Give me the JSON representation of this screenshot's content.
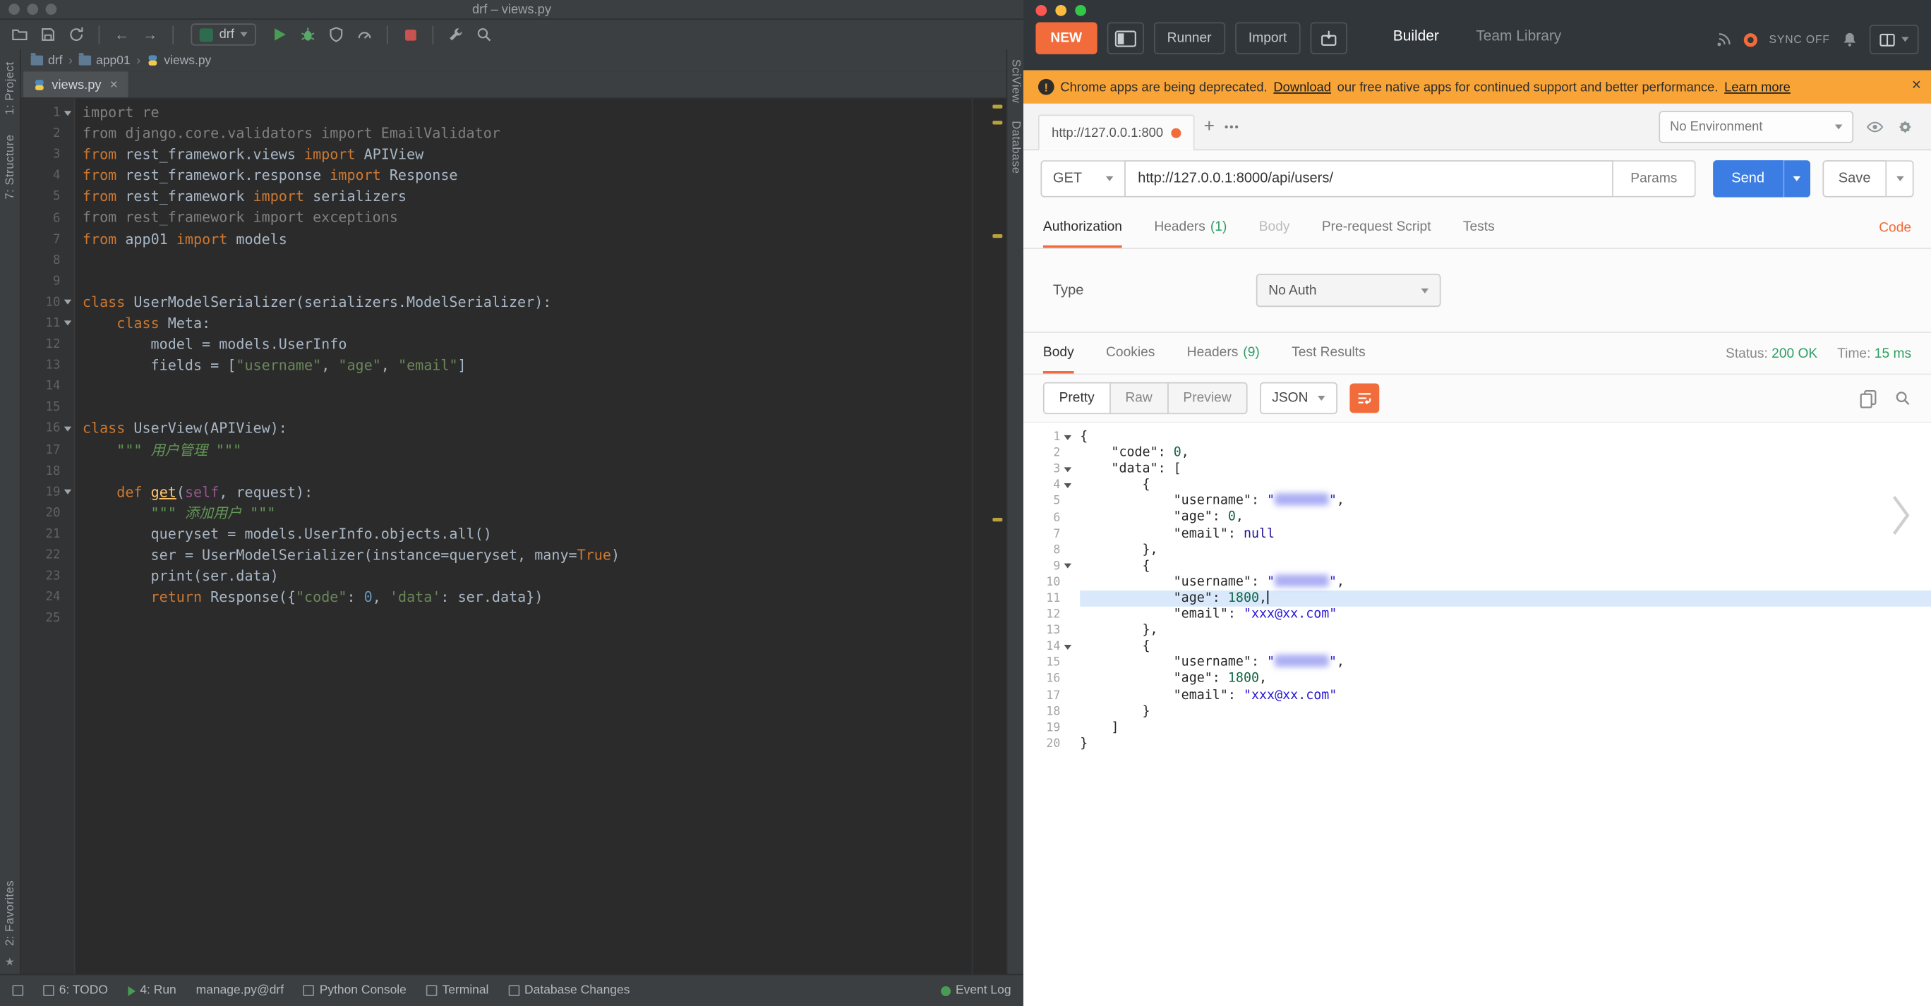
{
  "colors": {
    "ide-bg": "#2b2b2b",
    "ide-panel": "#3c3f41",
    "dar-kw": "#cc7832",
    "dar-txt": "#a9b7c6",
    "dar-gray": "#808080",
    "dar-str": "#6a8759",
    "dar-doc": "#629755",
    "dar-num": "#6897bb",
    "dar-fn": "#ffc66d",
    "dar-self": "#94558d",
    "pm-header": "#30363a",
    "pm-bg": "#fbfbfb",
    "accent": "#f26b3a",
    "banner": "#f8a437",
    "send-blue": "#3b7de3",
    "green": "#2d9e63",
    "json-p": "#262626",
    "json-key": "#262626",
    "json-num": "#116644",
    "json-str": "#2a16d8",
    "json-atom": "#221199",
    "active-line": "#d9e8fb",
    "blur": "#8f93ef"
  },
  "ide": {
    "titlebar": {
      "title": "drf – views.py"
    },
    "toolbar": {
      "run_config": "drf"
    },
    "breadcrumbs": [
      {
        "label": "drf"
      },
      {
        "label": "app01"
      },
      {
        "label": "views.py"
      }
    ],
    "left_stripe": {
      "items_top": [
        "1: Project",
        "7: Structure"
      ],
      "items_bottom": [
        "2: Favorites"
      ]
    },
    "right_stripe": {
      "items": [
        "SciView",
        "Database"
      ]
    },
    "editor_tab": {
      "label": "views.py"
    },
    "code": {
      "fold_lines": [
        1,
        10,
        11,
        16,
        19
      ],
      "lines": [
        [
          {
            "c": "gray",
            "t": "import re"
          }
        ],
        [
          {
            "c": "gray",
            "t": "from django.core.validators import EmailValidator"
          }
        ],
        [
          {
            "c": "kw",
            "t": "from"
          },
          {
            "c": "txt",
            "t": " rest_framework.views "
          },
          {
            "c": "kw",
            "t": "import"
          },
          {
            "c": "txt",
            "t": " APIView"
          }
        ],
        [
          {
            "c": "kw",
            "t": "from"
          },
          {
            "c": "txt",
            "t": " rest_framework.response "
          },
          {
            "c": "kw",
            "t": "import"
          },
          {
            "c": "txt",
            "t": " Response"
          }
        ],
        [
          {
            "c": "kw",
            "t": "from"
          },
          {
            "c": "txt",
            "t": " rest_framework "
          },
          {
            "c": "kw",
            "t": "import"
          },
          {
            "c": "txt",
            "t": " serializers"
          }
        ],
        [
          {
            "c": "gray",
            "t": "from rest_framework import exceptions"
          }
        ],
        [
          {
            "c": "kw",
            "t": "from"
          },
          {
            "c": "txt",
            "t": " app01 "
          },
          {
            "c": "kw",
            "t": "import"
          },
          {
            "c": "txt",
            "t": " models"
          }
        ],
        [],
        [],
        [
          {
            "c": "kw",
            "t": "class"
          },
          {
            "c": "txt",
            "t": " UserModelSerializer(serializers.ModelSerializer):"
          }
        ],
        [
          {
            "c": "txt",
            "t": "    "
          },
          {
            "c": "kw",
            "t": "class"
          },
          {
            "c": "txt",
            "t": " Meta:"
          }
        ],
        [
          {
            "c": "txt",
            "t": "        model = models.UserInfo"
          }
        ],
        [
          {
            "c": "txt",
            "t": "        fields = ["
          },
          {
            "c": "str",
            "t": "\"username\""
          },
          {
            "c": "txt",
            "t": ", "
          },
          {
            "c": "str",
            "t": "\"age\""
          },
          {
            "c": "txt",
            "t": ", "
          },
          {
            "c": "str",
            "t": "\"email\""
          },
          {
            "c": "txt",
            "t": "]"
          }
        ],
        [],
        [],
        [
          {
            "c": "kw",
            "t": "class"
          },
          {
            "c": "txt",
            "t": " UserView(APIView):"
          }
        ],
        [
          {
            "c": "txt",
            "t": "    "
          },
          {
            "c": "doc",
            "t": "\"\"\" 用户管理 \"\"\""
          }
        ],
        [],
        [
          {
            "c": "txt",
            "t": "    "
          },
          {
            "c": "kw",
            "t": "def"
          },
          {
            "c": "txt",
            "t": " "
          },
          {
            "c": "fn",
            "t": "get"
          },
          {
            "c": "txt",
            "t": "("
          },
          {
            "c": "selfc",
            "t": "self"
          },
          {
            "c": "txt",
            "t": ", request):"
          }
        ],
        [
          {
            "c": "txt",
            "t": "        "
          },
          {
            "c": "doc",
            "t": "\"\"\" 添加用户 \"\"\""
          }
        ],
        [
          {
            "c": "txt",
            "t": "        queryset = models.UserInfo.objects.all()"
          }
        ],
        [
          {
            "c": "txt",
            "t": "        ser = UserModelSerializer(instance=queryset, many="
          },
          {
            "c": "kw",
            "t": "True"
          },
          {
            "c": "txt",
            "t": ")"
          }
        ],
        [
          {
            "c": "txt",
            "t": "        print(ser.data)"
          }
        ],
        [
          {
            "c": "txt",
            "t": "        "
          },
          {
            "c": "kw",
            "t": "return"
          },
          {
            "c": "txt",
            "t": " Response({"
          },
          {
            "c": "str",
            "t": "\"code\""
          },
          {
            "c": "txt",
            "t": ": "
          },
          {
            "c": "num",
            "t": "0"
          },
          {
            "c": "txt",
            "t": ", "
          },
          {
            "c": "str",
            "t": "'data'"
          },
          {
            "c": "txt",
            "t": ": ser.data})"
          }
        ],
        []
      ]
    },
    "statusbar": {
      "items": [
        {
          "label": "6: TODO"
        },
        {
          "label": "4: Run"
        },
        {
          "label": "manage.py@drf"
        },
        {
          "label": "Python Console"
        },
        {
          "label": "Terminal"
        },
        {
          "label": "Database Changes"
        }
      ],
      "right": {
        "label": "Event Log"
      }
    }
  },
  "postman": {
    "header": {
      "new_label": "NEW",
      "runner_label": "Runner",
      "import_label": "Import",
      "tabs": [
        {
          "label": "Builder"
        },
        {
          "label": "Team Library"
        }
      ],
      "sync_label": "SYNC OFF"
    },
    "banner": {
      "text_before": "Chrome apps are being deprecated.",
      "link1": "Download",
      "text_mid": "our free native apps for continued support and better performance.",
      "link2": "Learn more"
    },
    "tabstrip": {
      "tab_label": "http://127.0.0.1:800",
      "env_select": "No Environment"
    },
    "request": {
      "method": "GET",
      "url": "http://127.0.0.1:8000/api/users/",
      "params_label": "Params",
      "send_label": "Send",
      "save_label": "Save"
    },
    "req_tabs": {
      "items": [
        {
          "label": "Authorization"
        },
        {
          "label": "Headers",
          "count": "(1)"
        },
        {
          "label": "Body"
        },
        {
          "label": "Pre-request Script"
        },
        {
          "label": "Tests"
        }
      ],
      "code_link": "Code"
    },
    "auth": {
      "type_label": "Type",
      "type_value": "No Auth"
    },
    "response": {
      "tabs": [
        {
          "label": "Body"
        },
        {
          "label": "Cookies"
        },
        {
          "label": "Headers",
          "count": "(9)"
        },
        {
          "label": "Test Results"
        }
      ],
      "status_label": "Status:",
      "status_value": "200 OK",
      "time_label": "Time:",
      "time_value": "15 ms",
      "view_modes": [
        {
          "label": "Pretty"
        },
        {
          "label": "Raw"
        },
        {
          "label": "Preview"
        }
      ],
      "language": "JSON",
      "viewer": {
        "active_line": 11,
        "fold_lines": [
          1,
          3,
          4,
          9,
          14
        ],
        "lines": [
          [
            {
              "c": "p",
              "t": "{"
            }
          ],
          [
            {
              "c": "p",
              "t": "    "
            },
            {
              "c": "key",
              "t": "\"code\""
            },
            {
              "c": "p",
              "t": ": "
            },
            {
              "c": "num2",
              "t": "0"
            },
            {
              "c": "p",
              "t": ","
            }
          ],
          [
            {
              "c": "p",
              "t": "    "
            },
            {
              "c": "key",
              "t": "\"data\""
            },
            {
              "c": "p",
              "t": ": ["
            }
          ],
          [
            {
              "c": "p",
              "t": "        {"
            }
          ],
          [
            {
              "c": "p",
              "t": "            "
            },
            {
              "c": "key",
              "t": "\"username\""
            },
            {
              "c": "p",
              "t": ": "
            },
            {
              "c": "str2",
              "t": "\""
            },
            {
              "c": "blur",
              "t": ""
            },
            {
              "c": "str2",
              "t": "\""
            },
            {
              "c": "p",
              "t": ","
            }
          ],
          [
            {
              "c": "p",
              "t": "            "
            },
            {
              "c": "key",
              "t": "\"age\""
            },
            {
              "c": "p",
              "t": ": "
            },
            {
              "c": "num2",
              "t": "0"
            },
            {
              "c": "p",
              "t": ","
            }
          ],
          [
            {
              "c": "p",
              "t": "            "
            },
            {
              "c": "key",
              "t": "\"email\""
            },
            {
              "c": "p",
              "t": ": "
            },
            {
              "c": "atom",
              "t": "null"
            }
          ],
          [
            {
              "c": "p",
              "t": "        },"
            }
          ],
          [
            {
              "c": "p",
              "t": "        {"
            }
          ],
          [
            {
              "c": "p",
              "t": "            "
            },
            {
              "c": "key",
              "t": "\"username\""
            },
            {
              "c": "p",
              "t": ": "
            },
            {
              "c": "str2",
              "t": "\""
            },
            {
              "c": "blur",
              "t": ""
            },
            {
              "c": "str2",
              "t": "\""
            },
            {
              "c": "p",
              "t": ","
            }
          ],
          [
            {
              "c": "p",
              "t": "            "
            },
            {
              "c": "key",
              "t": "\"age\""
            },
            {
              "c": "p",
              "t": ": "
            },
            {
              "c": "num2",
              "t": "1800"
            },
            {
              "c": "p",
              "t": ","
            },
            {
              "c": "caret",
              "t": ""
            }
          ],
          [
            {
              "c": "p",
              "t": "            "
            },
            {
              "c": "key",
              "t": "\"email\""
            },
            {
              "c": "p",
              "t": ": "
            },
            {
              "c": "str2",
              "t": "\"xxx@xx.com\""
            }
          ],
          [
            {
              "c": "p",
              "t": "        },"
            }
          ],
          [
            {
              "c": "p",
              "t": "        {"
            }
          ],
          [
            {
              "c": "p",
              "t": "            "
            },
            {
              "c": "key",
              "t": "\"username\""
            },
            {
              "c": "p",
              "t": ": "
            },
            {
              "c": "str2",
              "t": "\""
            },
            {
              "c": "blur",
              "t": ""
            },
            {
              "c": "str2",
              "t": "\""
            },
            {
              "c": "p",
              "t": ","
            }
          ],
          [
            {
              "c": "p",
              "t": "            "
            },
            {
              "c": "key",
              "t": "\"age\""
            },
            {
              "c": "p",
              "t": ": "
            },
            {
              "c": "num2",
              "t": "1800"
            },
            {
              "c": "p",
              "t": ","
            }
          ],
          [
            {
              "c": "p",
              "t": "            "
            },
            {
              "c": "key",
              "t": "\"email\""
            },
            {
              "c": "p",
              "t": ": "
            },
            {
              "c": "str2",
              "t": "\"xxx@xx.com\""
            }
          ],
          [
            {
              "c": "p",
              "t": "        }"
            }
          ],
          [
            {
              "c": "p",
              "t": "    ]"
            }
          ],
          [
            {
              "c": "p",
              "t": "}"
            }
          ]
        ]
      }
    }
  }
}
